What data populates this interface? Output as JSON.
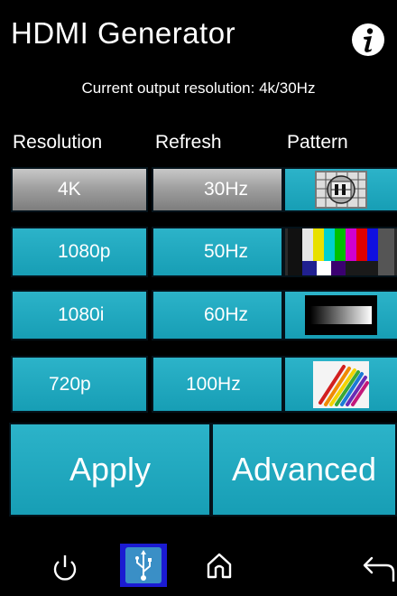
{
  "header": {
    "title": "HDMI Generator",
    "info_icon": "info-icon",
    "status": "Current output resolution: 4k/30Hz"
  },
  "columns": {
    "resolution": "Resolution",
    "refresh": "Refresh",
    "pattern": "Pattern"
  },
  "rows": [
    {
      "resolution": "4K",
      "refresh": "30Hz",
      "pattern": "test-card-pattern",
      "selected": true
    },
    {
      "resolution": "1080p",
      "refresh": "50Hz",
      "pattern": "color-bars-pattern",
      "selected": false
    },
    {
      "resolution": "1080i",
      "refresh": "60Hz",
      "pattern": "gradient-ramp-pattern",
      "selected": false
    },
    {
      "resolution": "720p",
      "refresh": "100Hz",
      "pattern": "colored-pencils-pattern",
      "selected": false
    }
  ],
  "actions": {
    "apply": "Apply",
    "advanced": "Advanced"
  },
  "bottom_nav": {
    "icons": [
      "power-icon",
      "usb-icon",
      "home-icon",
      "back-icon"
    ],
    "active": "usb-icon"
  },
  "colors": {
    "accent": "#1faac1",
    "selected": "#a9a9a9",
    "active_nav": "#1b1bd2",
    "background": "#000000"
  }
}
